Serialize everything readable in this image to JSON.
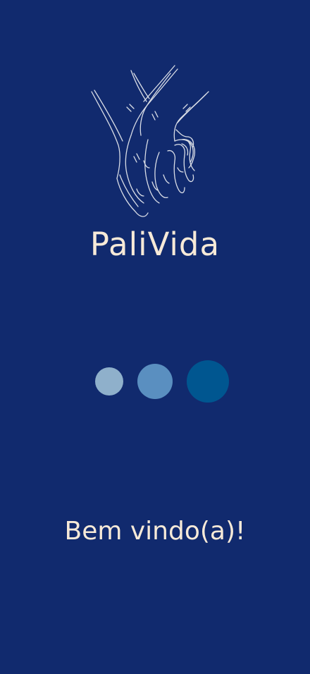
{
  "colors": {
    "background": "#112a6e",
    "text": "#f7ead8",
    "dot_light": "#8fb0cb",
    "dot_medium": "#5a8fc0",
    "dot_dark": "#005690",
    "illustration_stroke": "#d9dde6"
  },
  "splash": {
    "logo_icon": "holding-hands-icon",
    "app_name": "PaliVida",
    "loading_indicator": [
      "dot-small",
      "dot-medium",
      "dot-large"
    ],
    "welcome_text": "Bem vindo(a)!"
  }
}
